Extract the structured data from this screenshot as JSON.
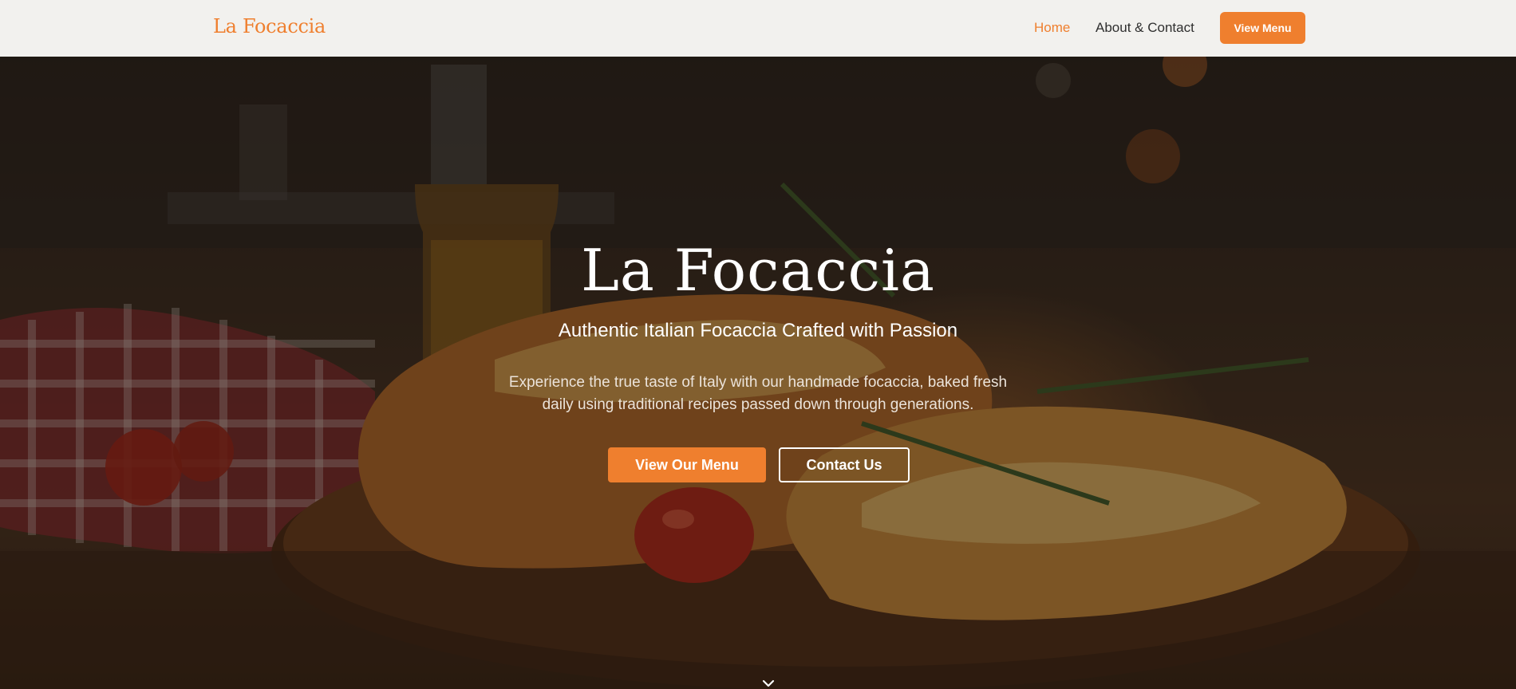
{
  "navbar": {
    "brand": "La Focaccia",
    "links": [
      {
        "label": "Home",
        "active": true
      },
      {
        "label": "About & Contact",
        "active": false
      }
    ],
    "cta_label": "View Menu"
  },
  "hero": {
    "title": "La Focaccia",
    "subtitle": "Authentic Italian Focaccia Crafted with Passion",
    "description": "Experience the true taste of Italy with our handmade focaccia, baked fresh daily using traditional recipes passed down through generations.",
    "primary_button": "View Our Menu",
    "secondary_button": "Contact Us",
    "scroll_icon": "chevron-down-icon"
  },
  "colors": {
    "accent": "#ef7f2e",
    "navbar_bg": "#f2f1ee",
    "nav_text": "#2f2f2f"
  }
}
